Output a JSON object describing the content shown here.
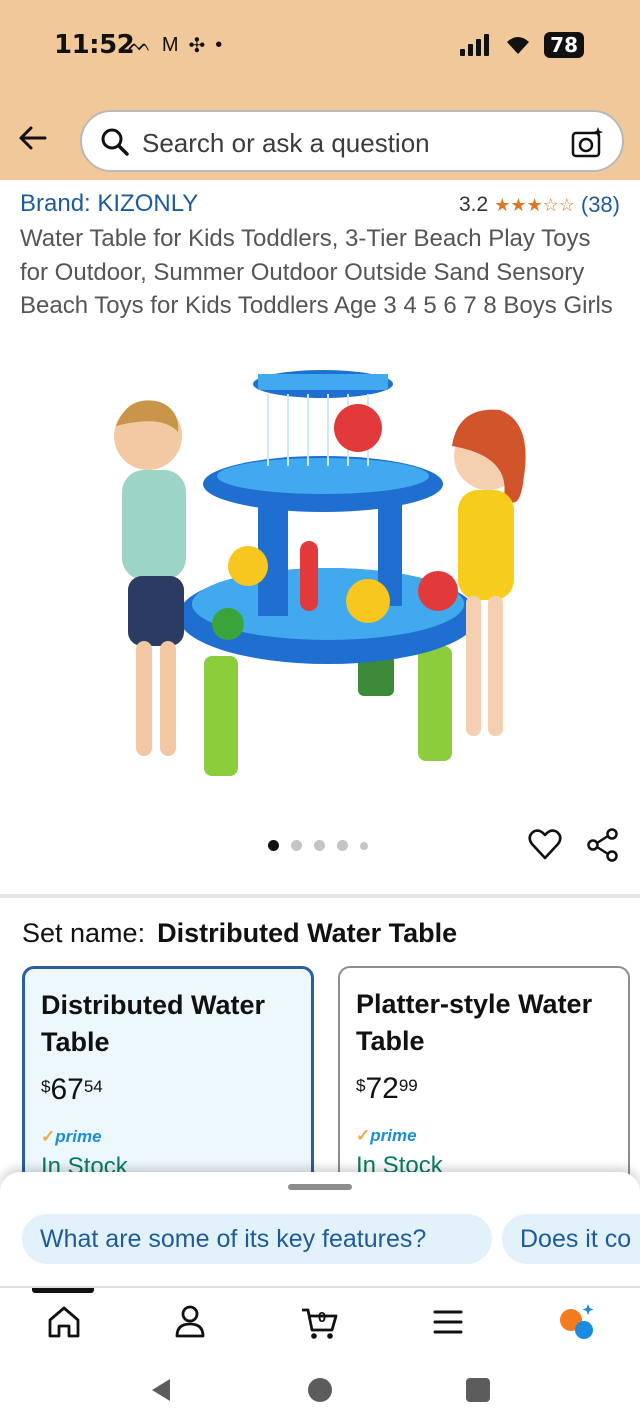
{
  "status_bar": {
    "time": "11:52",
    "battery": "78",
    "notification_icons": [
      "bird-icon",
      "gmail-icon",
      "pinwheel-icon",
      "dot-icon"
    ]
  },
  "search": {
    "placeholder": "Search or ask a question"
  },
  "product": {
    "brand": "Brand: KIZONLY",
    "rating_value": "3.2",
    "stars": "★★★☆☆",
    "rating_count": "(38)",
    "title": "Water Table for Kids Toddlers, 3-Tier Beach Play Toys for Outdoor, Summer Outdoor Outside Sand Sensory Beach Toys for Kids Toddlers Age 3 4 5 6 7 8 Boys Girls",
    "image_count": 5,
    "active_image_index": 0
  },
  "set_name": {
    "label": "Set name:",
    "value": "Distributed Water Table"
  },
  "options": [
    {
      "title": "Distributed Water Table",
      "price_symbol": "$",
      "price_whole": "67",
      "price_cents": "54",
      "prime": "prime",
      "stock": "In Stock",
      "selected": true
    },
    {
      "title": "Platter-style Water Table",
      "price_symbol": "$",
      "price_whole": "72",
      "price_cents": "99",
      "prime": "prime",
      "stock": "In Stock",
      "selected": false
    }
  ],
  "suggestions": {
    "chip1": "What are some of its key features?",
    "chip2": "Does it co"
  },
  "bottom_nav": {
    "cart_count": "0",
    "items": [
      "home-icon",
      "account-icon",
      "cart-icon",
      "menu-icon",
      "rufus-icon"
    ]
  },
  "colors": {
    "header_bg": "#f0c89a",
    "link": "#1f5b9a",
    "stars": "#de7921",
    "in_stock": "#067d62",
    "selected_border": "#2a5ea0",
    "prime": "#1c8ed6"
  }
}
